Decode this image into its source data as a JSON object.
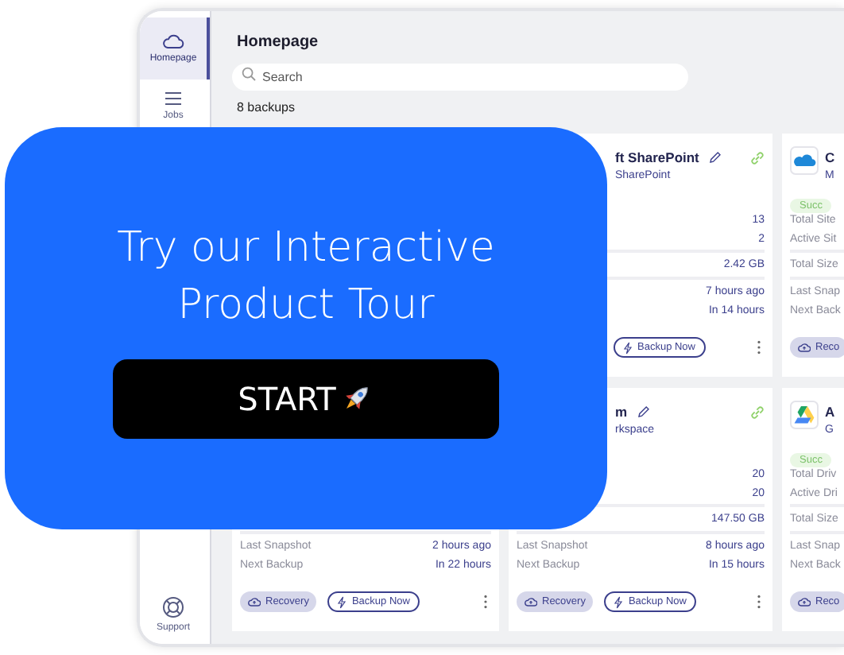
{
  "sidebar": {
    "items": [
      {
        "label": "Homepage",
        "selected": true
      },
      {
        "label": "Jobs",
        "selected": false
      }
    ],
    "footer": {
      "label": "Support",
      "selected": false
    }
  },
  "header": {
    "title": "Homepage"
  },
  "search": {
    "placeholder": "Search"
  },
  "count": "8 backups",
  "cards": [
    {
      "title": "ft SharePoint",
      "subtitle": "SharePoint",
      "editable": true,
      "linked": true,
      "stats": [
        {
          "value": "13"
        },
        {
          "value": "2"
        }
      ],
      "size": {
        "value": "2.42 GB"
      },
      "schedule": [
        {
          "value": "7 hours ago"
        },
        {
          "value": "In 14 hours"
        }
      ],
      "actions": [
        {
          "kind": "backup",
          "label": "Backup Now"
        }
      ],
      "more": true
    },
    {
      "title": "C",
      "subtitle": "M",
      "badge": "Succ",
      "stats": [
        {
          "label": "Total Site"
        },
        {
          "label": "Active Sit"
        }
      ],
      "size": {
        "label": "Total Size"
      },
      "schedule": [
        {
          "label": "Last Snap"
        },
        {
          "label": "Next Back"
        }
      ],
      "actions": [
        {
          "kind": "recovery",
          "label": "Reco"
        }
      ]
    },
    {
      "schedule": [
        {
          "label": "Last Snapshot",
          "value": "2 hours ago"
        },
        {
          "label": "Next Backup",
          "value": "In 22 hours"
        }
      ],
      "actions": [
        {
          "kind": "recovery",
          "label": "Recovery"
        },
        {
          "kind": "backup",
          "label": "Backup Now"
        }
      ],
      "more": true
    },
    {
      "title": "m",
      "subtitle": "rkspace",
      "editable": true,
      "linked": true,
      "stats": [
        {
          "value": "20"
        },
        {
          "value": "20"
        }
      ],
      "size": {
        "value": "147.50 GB"
      },
      "schedule": [
        {
          "label": "Last Snapshot",
          "value": "8 hours ago"
        },
        {
          "label": "Next Backup",
          "value": "In 15 hours"
        }
      ],
      "actions": [
        {
          "kind": "recovery",
          "label": "Recovery"
        },
        {
          "kind": "backup",
          "label": "Backup Now"
        }
      ],
      "more": true
    },
    {
      "title": "A",
      "subtitle": "G",
      "badge": "Succ",
      "stats": [
        {
          "label": "Total Driv"
        },
        {
          "label": "Active Dri"
        }
      ],
      "size": {
        "label": "Total Size"
      },
      "schedule": [
        {
          "label": "Last Snap"
        },
        {
          "label": "Next Back"
        }
      ],
      "actions": [
        {
          "kind": "recovery",
          "label": "Reco"
        }
      ]
    }
  ],
  "tour": {
    "title": "Try our Interactive Product Tour",
    "button": "START"
  }
}
